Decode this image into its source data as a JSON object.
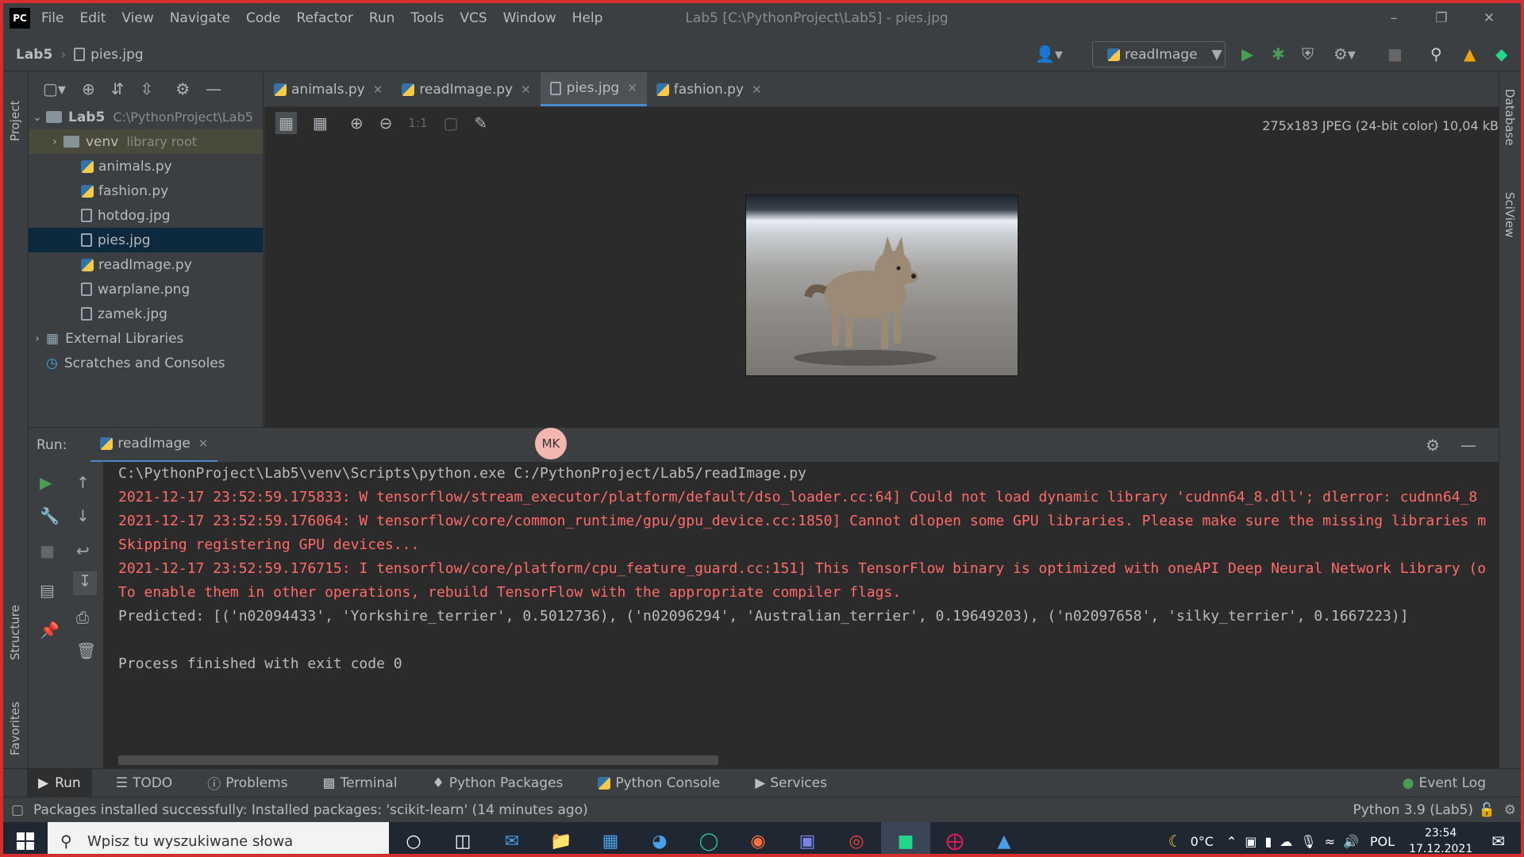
{
  "titlebar": {
    "menu": [
      "File",
      "Edit",
      "View",
      "Navigate",
      "Code",
      "Refactor",
      "Run",
      "Tools",
      "VCS",
      "Window",
      "Help"
    ],
    "window_title": "Lab5 [C:\\PythonProject\\Lab5] - pies.jpg"
  },
  "navbar": {
    "project": "Lab5",
    "file": "pies.jpg",
    "run_config": "readImage"
  },
  "sidebar": {
    "project_label": "Project",
    "structure_label": "Structure",
    "favorites_label": "Favorites",
    "database_label": "Database",
    "sciview_label": "SciView"
  },
  "project_tree": {
    "root_name": "Lab5",
    "root_path": "C:\\PythonProject\\Lab5",
    "venv_name": "venv",
    "venv_hint": "library root",
    "files": [
      "animals.py",
      "fashion.py",
      "hotdog.jpg",
      "pies.jpg",
      "readImage.py",
      "warplane.png",
      "zamek.jpg"
    ],
    "external_libraries": "External Libraries",
    "scratches": "Scratches and Consoles"
  },
  "editor": {
    "tabs": [
      "animals.py",
      "readImage.py",
      "pies.jpg",
      "fashion.py"
    ],
    "active_tab": "pies.jpg",
    "image_info": "275x183 JPEG (24-bit color) 10,04 kB"
  },
  "run": {
    "label": "Run:",
    "tab": "readImage",
    "avatar": "MK",
    "lines": [
      "C:\\PythonProject\\Lab5\\venv\\Scripts\\python.exe C:/PythonProject/Lab5/readImage.py",
      "2021-12-17 23:52:59.175833: W tensorflow/stream_executor/platform/default/dso_loader.cc:64] Could not load dynamic library 'cudnn64_8.dll'; dlerror: cudnn64_8",
      "2021-12-17 23:52:59.176064: W tensorflow/core/common_runtime/gpu/gpu_device.cc:1850] Cannot dlopen some GPU libraries. Please make sure the missing libraries m",
      "Skipping registering GPU devices...",
      "2021-12-17 23:52:59.176715: I tensorflow/core/platform/cpu_feature_guard.cc:151] This TensorFlow binary is optimized with oneAPI Deep Neural Network Library (o",
      "To enable them in other operations, rebuild TensorFlow with the appropriate compiler flags.",
      "Predicted: [('n02094433', 'Yorkshire_terrier', 0.5012736), ('n02096294', 'Australian_terrier', 0.19649203), ('n02097658', 'silky_terrier', 0.1667223)]",
      "",
      "Process finished with exit code 0"
    ]
  },
  "bottom_tabs": [
    "Run",
    "TODO",
    "Problems",
    "Terminal",
    "Python Packages",
    "Python Console",
    "Services"
  ],
  "event_log": "Event Log",
  "status": {
    "message": "Packages installed successfully: Installed packages: 'scikit-learn' (14 minutes ago)",
    "interpreter": "Python 3.9 (Lab5)"
  },
  "taskbar": {
    "search_placeholder": "Wpisz tu wyszukiwane słowa",
    "temperature": "0°C",
    "language": "POL",
    "time": "23:54",
    "date": "17.12.2021"
  },
  "colors": {
    "error": "#ff6b68",
    "accent": "#4a88c7",
    "run_green": "#499c54"
  }
}
